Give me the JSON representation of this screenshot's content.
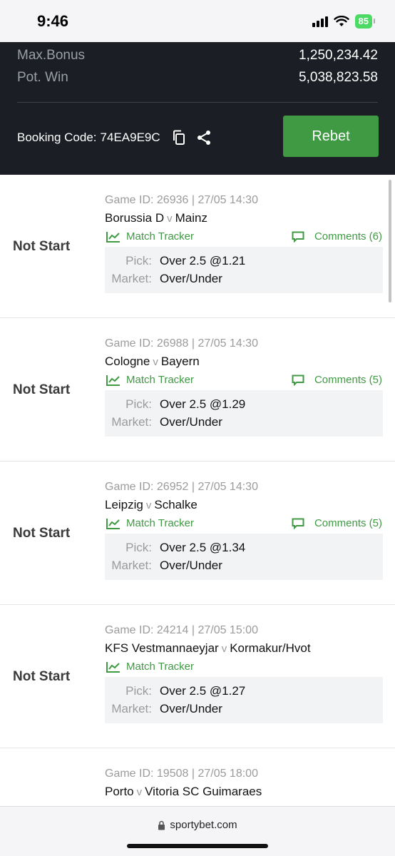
{
  "status_bar": {
    "time": "9:46",
    "battery": "85"
  },
  "summary": {
    "max_bonus_label": "Max.Bonus",
    "max_bonus_value": "1,250,234.42",
    "pot_win_label": "Pot. Win",
    "pot_win_value": "5,038,823.58",
    "booking_code_label": "Booking Code:",
    "booking_code_value": "74EA9E9C",
    "rebet_label": "Rebet"
  },
  "bets": [
    {
      "state": "Not Start",
      "game_id": "Game ID: 26936 | 27/05 14:30",
      "home": "Borussia D",
      "vs": "v",
      "away": "Mainz",
      "tracker": "Match Tracker",
      "comments": "Comments (6)",
      "pick_label": "Pick:",
      "pick": "Over 2.5 @1.21",
      "market_label": "Market:",
      "market": "Over/Under"
    },
    {
      "state": "Not Start",
      "game_id": "Game ID: 26988 | 27/05 14:30",
      "home": "Cologne",
      "vs": "v",
      "away": "Bayern",
      "tracker": "Match Tracker",
      "comments": "Comments (5)",
      "pick_label": "Pick:",
      "pick": "Over 2.5 @1.29",
      "market_label": "Market:",
      "market": "Over/Under"
    },
    {
      "state": "Not Start",
      "game_id": "Game ID: 26952 | 27/05 14:30",
      "home": "Leipzig",
      "vs": "v",
      "away": "Schalke",
      "tracker": "Match Tracker",
      "comments": "Comments (5)",
      "pick_label": "Pick:",
      "pick": "Over 2.5 @1.34",
      "market_label": "Market:",
      "market": "Over/Under"
    },
    {
      "state": "Not Start",
      "game_id": "Game ID: 24214 | 27/05 15:00",
      "home": "KFS Vestmannaeyjar",
      "vs": "v",
      "away": "Kormakur/Hvot",
      "tracker": "Match Tracker",
      "pick_label": "Pick:",
      "pick": "Over 2.5 @1.27",
      "market_label": "Market:",
      "market": "Over/Under"
    },
    {
      "game_id": "Game ID: 19508 | 27/05 18:00",
      "home": "Porto",
      "vs": "v",
      "away": "Vitoria SC Guimaraes"
    }
  ],
  "browser": {
    "url": "sportybet.com"
  },
  "colors": {
    "accent": "#3f9a43",
    "header_bg": "#1b1e24",
    "pick_bg": "#f2f3f5"
  }
}
